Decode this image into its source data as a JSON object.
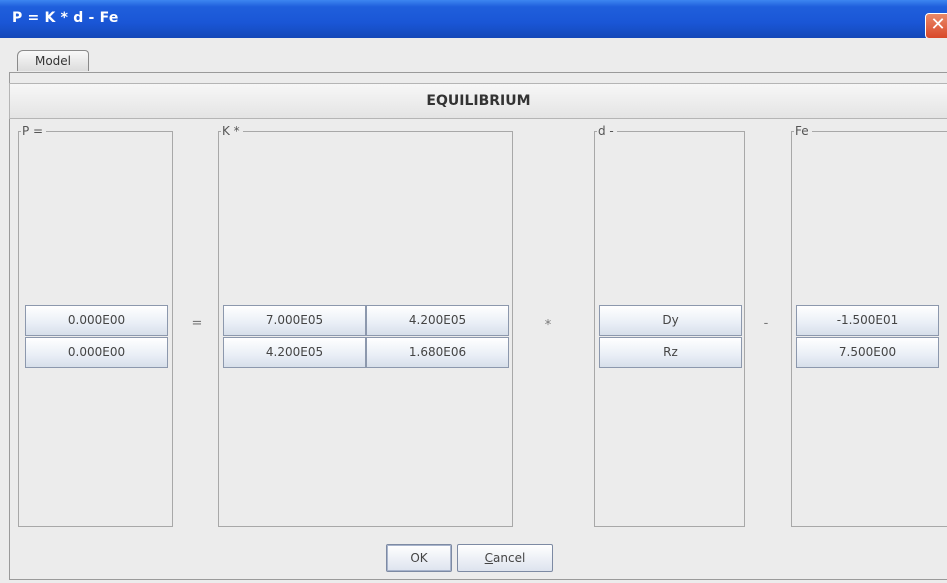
{
  "window": {
    "title": "P = K * d - Fe",
    "close_glyph": "✕"
  },
  "tabs": [
    {
      "label": "Model"
    }
  ],
  "header": {
    "title": "EQUILIBRIUM"
  },
  "groups": {
    "p": {
      "label": "P =",
      "values": [
        "0.000E00",
        "0.000E00"
      ]
    },
    "k": {
      "label": "K *",
      "matrix": [
        [
          "7.000E05",
          "4.200E05"
        ],
        [
          "4.200E05",
          "1.680E06"
        ]
      ]
    },
    "d": {
      "label": "d -",
      "values": [
        "Dy",
        "Rz"
      ]
    },
    "fe": {
      "label": "Fe",
      "values": [
        "-1.500E01",
        "7.500E00"
      ]
    }
  },
  "operators": {
    "equals": "=",
    "times": "*",
    "minus": "-"
  },
  "buttons": {
    "ok": "OK",
    "cancel_mnemonic": "C",
    "cancel_rest": "ancel"
  }
}
